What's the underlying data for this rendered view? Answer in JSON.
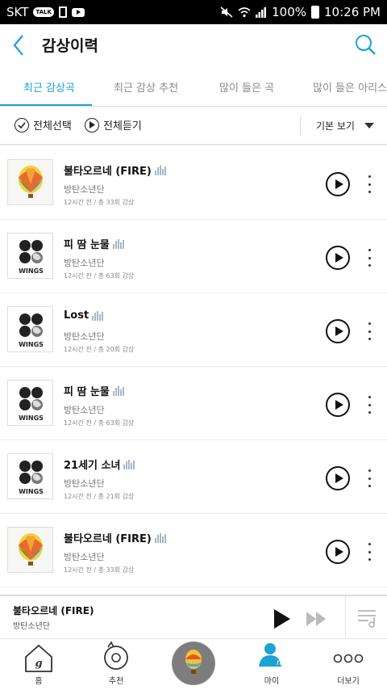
{
  "status_bar": {
    "carrier": "SKT",
    "talk_badge": "TALK",
    "battery_text": "100%",
    "time": "10:26 PM"
  },
  "header": {
    "title": "감상이력"
  },
  "tabs": [
    {
      "label": "최근 감상곡",
      "active": true
    },
    {
      "label": "최근 감상 추천",
      "active": false
    },
    {
      "label": "많이 들은 곡",
      "active": false
    },
    {
      "label": "많이 들은 아리스트",
      "active": false
    }
  ],
  "toolbar": {
    "select_all": "전체선택",
    "play_all": "전체듣기",
    "sort": "기본 보기"
  },
  "songs": [
    {
      "title": "불타오르네 (FIRE)",
      "artist": "방탄소년단",
      "meta": "12시간 전 / 총 33회 감상",
      "album": "balloon"
    },
    {
      "title": "피 땀 눈물",
      "artist": "방탄소년단",
      "meta": "12시간 전 / 총 63회 감상",
      "album": "wings"
    },
    {
      "title": "Lost",
      "artist": "방탄소년단",
      "meta": "12시간 전 / 총 20회 감상",
      "album": "wings"
    },
    {
      "title": "피 땀 눈물",
      "artist": "방탄소년단",
      "meta": "12시간 전 / 총 63회 감상",
      "album": "wings"
    },
    {
      "title": "21세기 소녀",
      "artist": "방탄소년단",
      "meta": "12시간 전 / 총 21회 감상",
      "album": "wings"
    },
    {
      "title": "불타오르네 (FIRE)",
      "artist": "방탄소년단",
      "meta": "12시간 전 / 총 33회 감상",
      "album": "balloon"
    }
  ],
  "album_text": {
    "wings": "WINGS"
  },
  "now_playing": {
    "title": "불타오르네 (FIRE)",
    "artist": "방탄소년단"
  },
  "bottom_nav": [
    {
      "label": "홈",
      "icon": "home-icon",
      "active": false
    },
    {
      "label": "추천",
      "icon": "recommend-icon",
      "active": false
    },
    {
      "label": "",
      "icon": "album-disc",
      "active": false
    },
    {
      "label": "마이",
      "icon": "my-icon",
      "active": true
    },
    {
      "label": "더보기",
      "icon": "more-icon",
      "active": false
    }
  ],
  "colors": {
    "accent": "#1aa3d4"
  }
}
